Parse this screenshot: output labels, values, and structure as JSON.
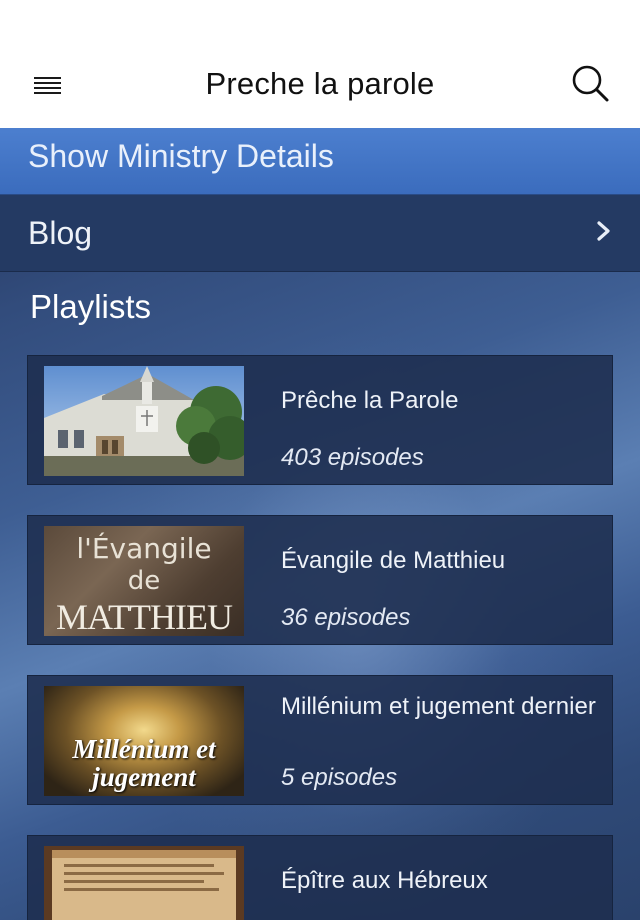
{
  "appbar": {
    "title": "Preche la parole",
    "menu_icon": "hamburger-menu-icon",
    "search_icon": "search-icon"
  },
  "ministry": {
    "label": "Show Ministry Details"
  },
  "blog": {
    "label": "Blog",
    "chevron_icon": "chevron-right-icon"
  },
  "playlists": {
    "title": "Playlists",
    "items": [
      {
        "title": "Prêche la Parole",
        "count": "403 episodes",
        "thumbnail": "church-building-photo"
      },
      {
        "title": "Évangile de Matthieu",
        "count": "36 episodes",
        "thumbnail_text": [
          "l'Évangile",
          "de",
          "MATTHIEU"
        ]
      },
      {
        "title": "Millénium et jugement dernier",
        "count": "5 episodes",
        "thumbnail_text": [
          "Millénium et",
          "jugement"
        ]
      },
      {
        "title": "Épître aux Hébreux",
        "count": "",
        "thumbnail": "scroll-parchment-photo"
      }
    ]
  },
  "colors": {
    "appbar_bg": "#ffffff",
    "ministry_bar": "#3f72c4",
    "blog_row": "#243a63",
    "card_bg": "#1e2e4e"
  }
}
